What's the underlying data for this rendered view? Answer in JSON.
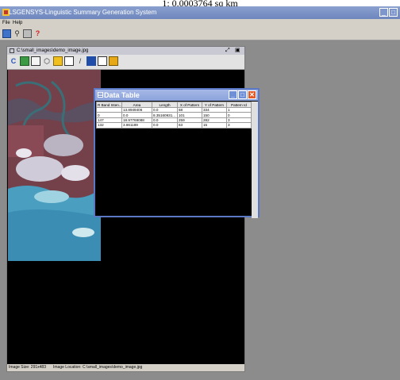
{
  "caption": "1: 0.0003764 sq km",
  "app": {
    "title": "LSGENSYS-Linguistic Summary Generation System",
    "menu": [
      "File",
      "Help"
    ]
  },
  "image_window": {
    "title": "C:\\small_images\\demo_image.jpg",
    "status_size": "Image Size: 291x483",
    "status_location": "Image Location: C:\\small_images\\demo_image.jpg"
  },
  "data_table": {
    "title": "Data Table",
    "columns": [
      "R Band Inten...",
      "Area",
      "Length",
      "X of Pattern",
      "Y of Pattern",
      "Pattern Id"
    ],
    "rows": [
      [
        "",
        "13.8949406",
        "0.0",
        "58",
        "334",
        "1"
      ],
      [
        "0",
        "0.0",
        "8.35160931...",
        "101",
        "150",
        "0"
      ],
      [
        "147",
        "18.97769088",
        "0.0",
        "259",
        "282",
        "3"
      ],
      [
        "132",
        "3.861189",
        "0.0",
        "63",
        "15",
        "3"
      ]
    ]
  },
  "colors": {
    "app_title": "#6d86bd",
    "workspace": "#8c8c8c",
    "dialog_title": "#8aa2db",
    "close_button": "#e05a2a"
  }
}
